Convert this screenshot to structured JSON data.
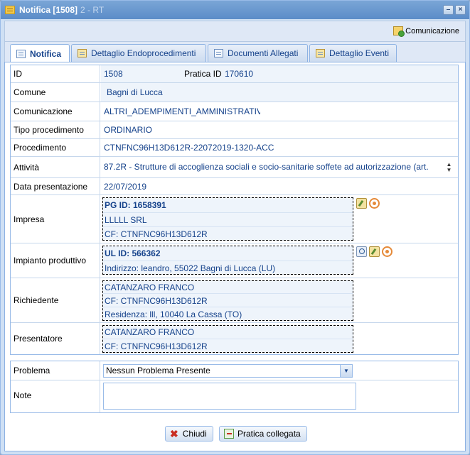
{
  "window": {
    "title": "Notifica [1508]",
    "title_ghost": "2 - RT"
  },
  "toolbar": {
    "comunicazione_label": "Comunicazione"
  },
  "tabs": [
    {
      "label": "Notifica",
      "active": true
    },
    {
      "label": "Dettaglio Endoprocedimenti",
      "active": false
    },
    {
      "label": "Documenti Allegati",
      "active": false
    },
    {
      "label": "Dettaglio Eventi",
      "active": false
    }
  ],
  "fields": {
    "id_label": "ID",
    "id_value": "1508",
    "pratica_label": "Pratica ID",
    "pratica_value": "170610",
    "comune_label": "Comune",
    "comune_value": "Bagni di Lucca",
    "comunicazione_label": "Comunicazione",
    "comunicazione_value": "ALTRI_ADEMPIMENTI_AMMINISTRATIV",
    "tipo_label": "Tipo procedimento",
    "tipo_value": "ORDINARIO",
    "procedimento_label": "Procedimento",
    "procedimento_value": "CTNFNC96H13D612R-22072019-1320-ACC",
    "attivita_label": "Attività",
    "attivita_value": "87.2R - Strutture di accoglienza sociali e socio-sanitarie soffete ad autorizzazione (art.",
    "data_label": "Data presentazione",
    "data_value": "22/07/2019"
  },
  "impresa": {
    "label": "Impresa",
    "pg_id": "PG ID: 1658391",
    "name": "LLLLL SRL",
    "cf": "CF: CTNFNC96H13D612R"
  },
  "impianto": {
    "label": "Impianto produttivo",
    "ul_id": "UL ID: 566362",
    "indirizzo": "Indirizzo: leandro, 55022 Bagni di Lucca (LU)"
  },
  "richiedente": {
    "label": "Richiedente",
    "name": "CATANZARO FRANCO",
    "cf": "CF: CTNFNC96H13D612R",
    "residenza": "Residenza: lll, 10040 La Cassa (TO)"
  },
  "presentatore": {
    "label": "Presentatore",
    "name": "CATANZARO FRANCO",
    "cf": "CF: CTNFNC96H13D612R"
  },
  "problema": {
    "label": "Problema",
    "selected": "Nessun Problema Presente"
  },
  "note": {
    "label": "Note",
    "value": ""
  },
  "buttons": {
    "chiudi": "Chiudi",
    "pratica_collegata": "Pratica collegata"
  }
}
